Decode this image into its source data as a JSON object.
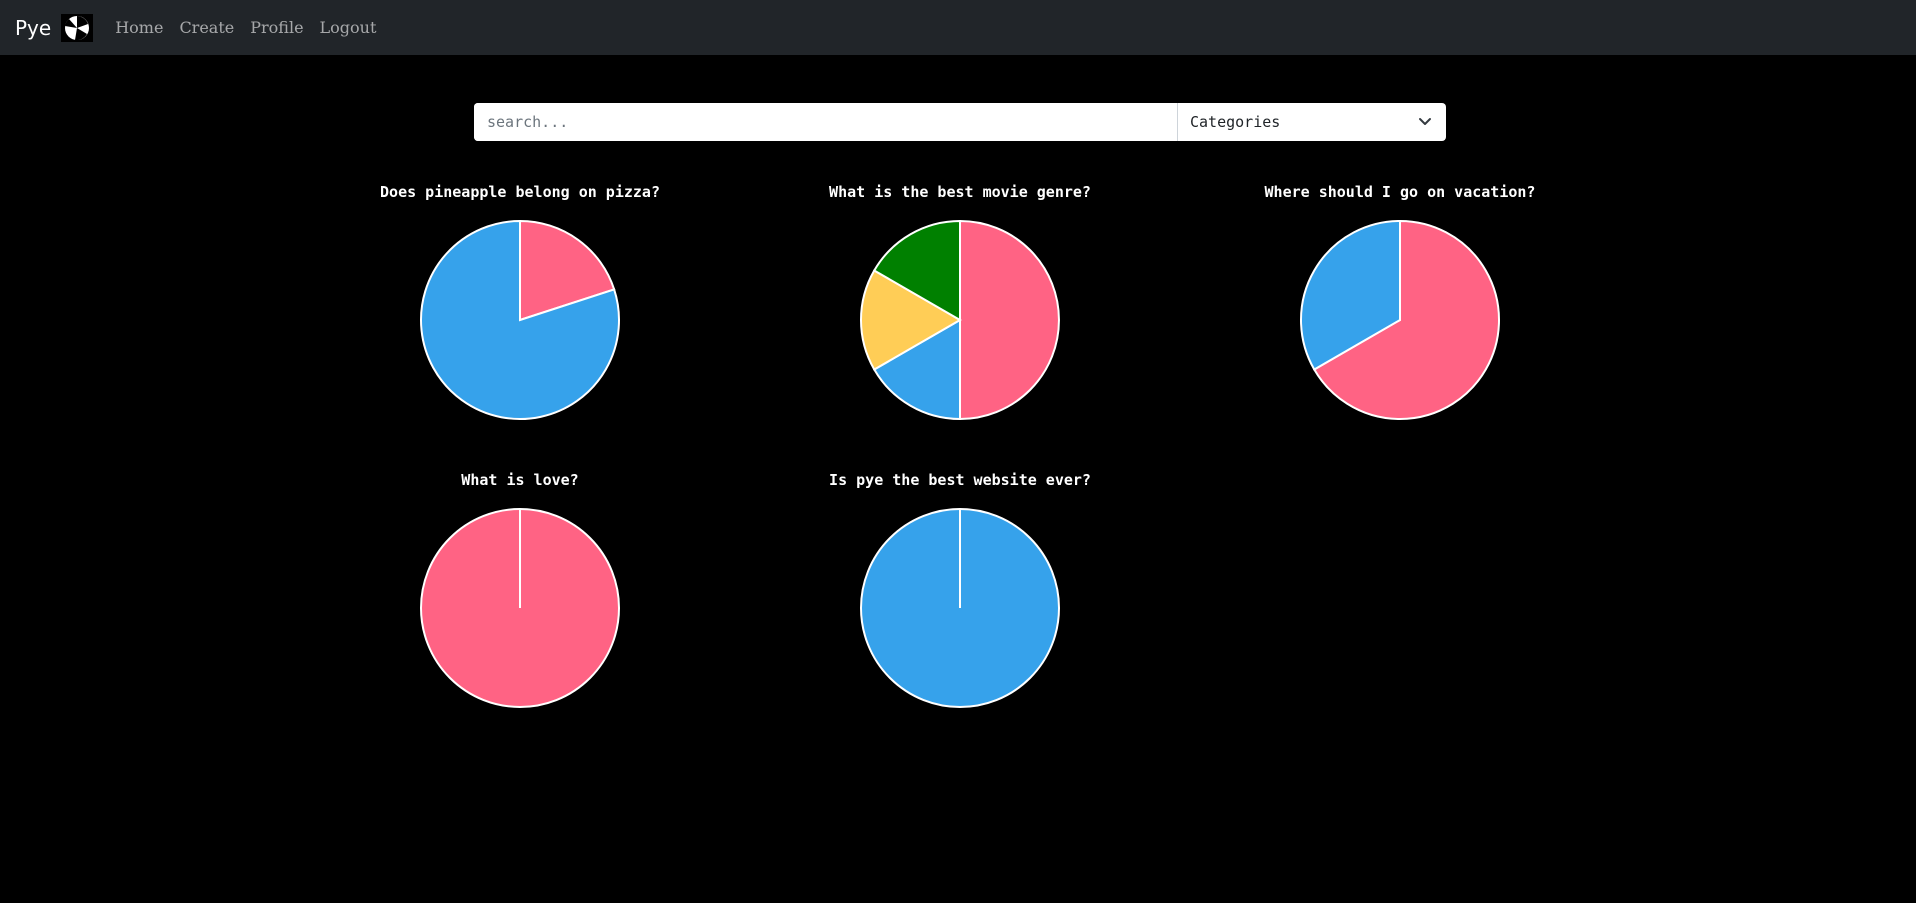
{
  "navbar": {
    "brand": "Pye",
    "links": [
      "Home",
      "Create",
      "Profile",
      "Logout"
    ]
  },
  "search": {
    "placeholder": "search...",
    "value": ""
  },
  "category_select": {
    "selected": "Categories"
  },
  "colors": {
    "navbar_bg": "#212529",
    "page_bg": "#000000",
    "pink": "#ff6384",
    "blue": "#36a2eb",
    "yellow": "#ffcd56",
    "green": "#008000",
    "slice_border": "#ffffff"
  },
  "chart_data": [
    {
      "type": "pie",
      "title": "Does pineapple belong on pizza?",
      "series": [
        {
          "values": [
            20,
            80
          ],
          "colors": [
            "#ff6384",
            "#36a2eb"
          ]
        }
      ]
    },
    {
      "type": "pie",
      "title": "What is the best movie genre?",
      "series": [
        {
          "values": [
            3,
            1,
            1,
            1
          ],
          "colors": [
            "#ff6384",
            "#36a2eb",
            "#ffcd56",
            "#008000"
          ]
        }
      ]
    },
    {
      "type": "pie",
      "title": "Where should I go on vacation?",
      "series": [
        {
          "values": [
            2,
            1
          ],
          "colors": [
            "#ff6384",
            "#36a2eb"
          ]
        }
      ]
    },
    {
      "type": "pie",
      "title": "What is love?",
      "series": [
        {
          "values": [
            1
          ],
          "colors": [
            "#ff6384"
          ]
        }
      ]
    },
    {
      "type": "pie",
      "title": "Is pye the best website ever?",
      "series": [
        {
          "values": [
            1
          ],
          "colors": [
            "#36a2eb"
          ]
        }
      ]
    }
  ]
}
